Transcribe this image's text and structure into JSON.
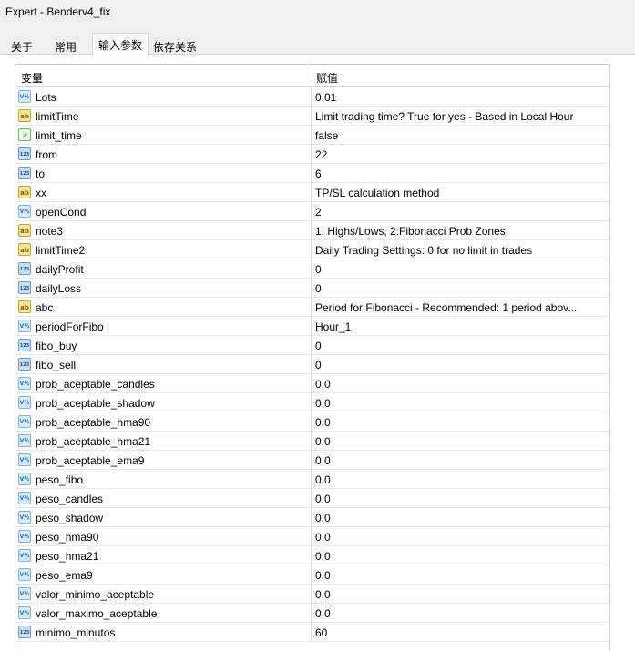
{
  "window": {
    "title": "Expert - Benderv4_fix"
  },
  "tabs": [
    {
      "label": "关于",
      "active": false
    },
    {
      "label": "常用",
      "active": false
    },
    {
      "label": "输入参数",
      "active": true
    },
    {
      "label": "依存关系",
      "active": false
    }
  ],
  "grid": {
    "headers": {
      "variable": "变量",
      "value": "赋值"
    },
    "rows": [
      {
        "icon": "double-icon",
        "badge": "V½",
        "name": "Lots",
        "value": "0.01"
      },
      {
        "icon": "string-icon",
        "badge": "ab",
        "name": "limitTime",
        "value": "Limit trading time? True for yes - Based in Local Hour"
      },
      {
        "icon": "bool-icon",
        "badge": "↗",
        "name": "limit_time",
        "value": "false"
      },
      {
        "icon": "int-icon",
        "badge": "123",
        "name": "from",
        "value": "22"
      },
      {
        "icon": "int-icon",
        "badge": "123",
        "name": "to",
        "value": "6"
      },
      {
        "icon": "string-icon",
        "badge": "ab",
        "name": "xx",
        "value": "TP/SL calculation method"
      },
      {
        "icon": "double-icon",
        "badge": "V½",
        "name": "openCond",
        "value": "2"
      },
      {
        "icon": "string-icon",
        "badge": "ab",
        "name": "note3",
        "value": "1: Highs/Lows, 2:Fibonacci Prob Zones"
      },
      {
        "icon": "string-icon",
        "badge": "ab",
        "name": "limitTime2",
        "value": "Daily Trading Settings: 0 for no limit in trades"
      },
      {
        "icon": "int-icon",
        "badge": "123",
        "name": "dailyProfit",
        "value": "0"
      },
      {
        "icon": "int-icon",
        "badge": "123",
        "name": "dailyLoss",
        "value": "0"
      },
      {
        "icon": "string-icon",
        "badge": "ab",
        "name": "abc",
        "value": "Period for Fibonacci - Recommended: 1 period abov..."
      },
      {
        "icon": "enum-icon",
        "badge": "V½",
        "name": "periodForFibo",
        "value": "Hour_1"
      },
      {
        "icon": "int-icon",
        "badge": "123",
        "name": "fibo_buy",
        "value": "0"
      },
      {
        "icon": "int-icon",
        "badge": "123",
        "name": "fibo_sell",
        "value": "0"
      },
      {
        "icon": "double-icon",
        "badge": "V½",
        "name": "prob_aceptable_candles",
        "value": "0.0"
      },
      {
        "icon": "double-icon",
        "badge": "V½",
        "name": "prob_aceptable_shadow",
        "value": "0.0"
      },
      {
        "icon": "double-icon",
        "badge": "V½",
        "name": "prob_aceptable_hma90",
        "value": "0.0"
      },
      {
        "icon": "double-icon",
        "badge": "V½",
        "name": "prob_aceptable_hma21",
        "value": "0.0"
      },
      {
        "icon": "double-icon",
        "badge": "V½",
        "name": "prob_aceptable_ema9",
        "value": "0.0"
      },
      {
        "icon": "double-icon",
        "badge": "V½",
        "name": "peso_fibo",
        "value": "0.0"
      },
      {
        "icon": "double-icon",
        "badge": "V½",
        "name": "peso_candles",
        "value": "0.0"
      },
      {
        "icon": "double-icon",
        "badge": "V½",
        "name": "peso_shadow",
        "value": "0.0"
      },
      {
        "icon": "double-icon",
        "badge": "V½",
        "name": "peso_hma90",
        "value": "0.0"
      },
      {
        "icon": "double-icon",
        "badge": "V½",
        "name": "peso_hma21",
        "value": "0.0"
      },
      {
        "icon": "double-icon",
        "badge": "V½",
        "name": "peso_ema9",
        "value": "0.0"
      },
      {
        "icon": "double-icon",
        "badge": "V½",
        "name": "valor_minimo_aceptable",
        "value": "0.0"
      },
      {
        "icon": "double-icon",
        "badge": "V½",
        "name": "valor_maximo_aceptable",
        "value": "0.0"
      },
      {
        "icon": "int-icon",
        "badge": "123",
        "name": "minimo_minutos",
        "value": "60"
      }
    ]
  }
}
